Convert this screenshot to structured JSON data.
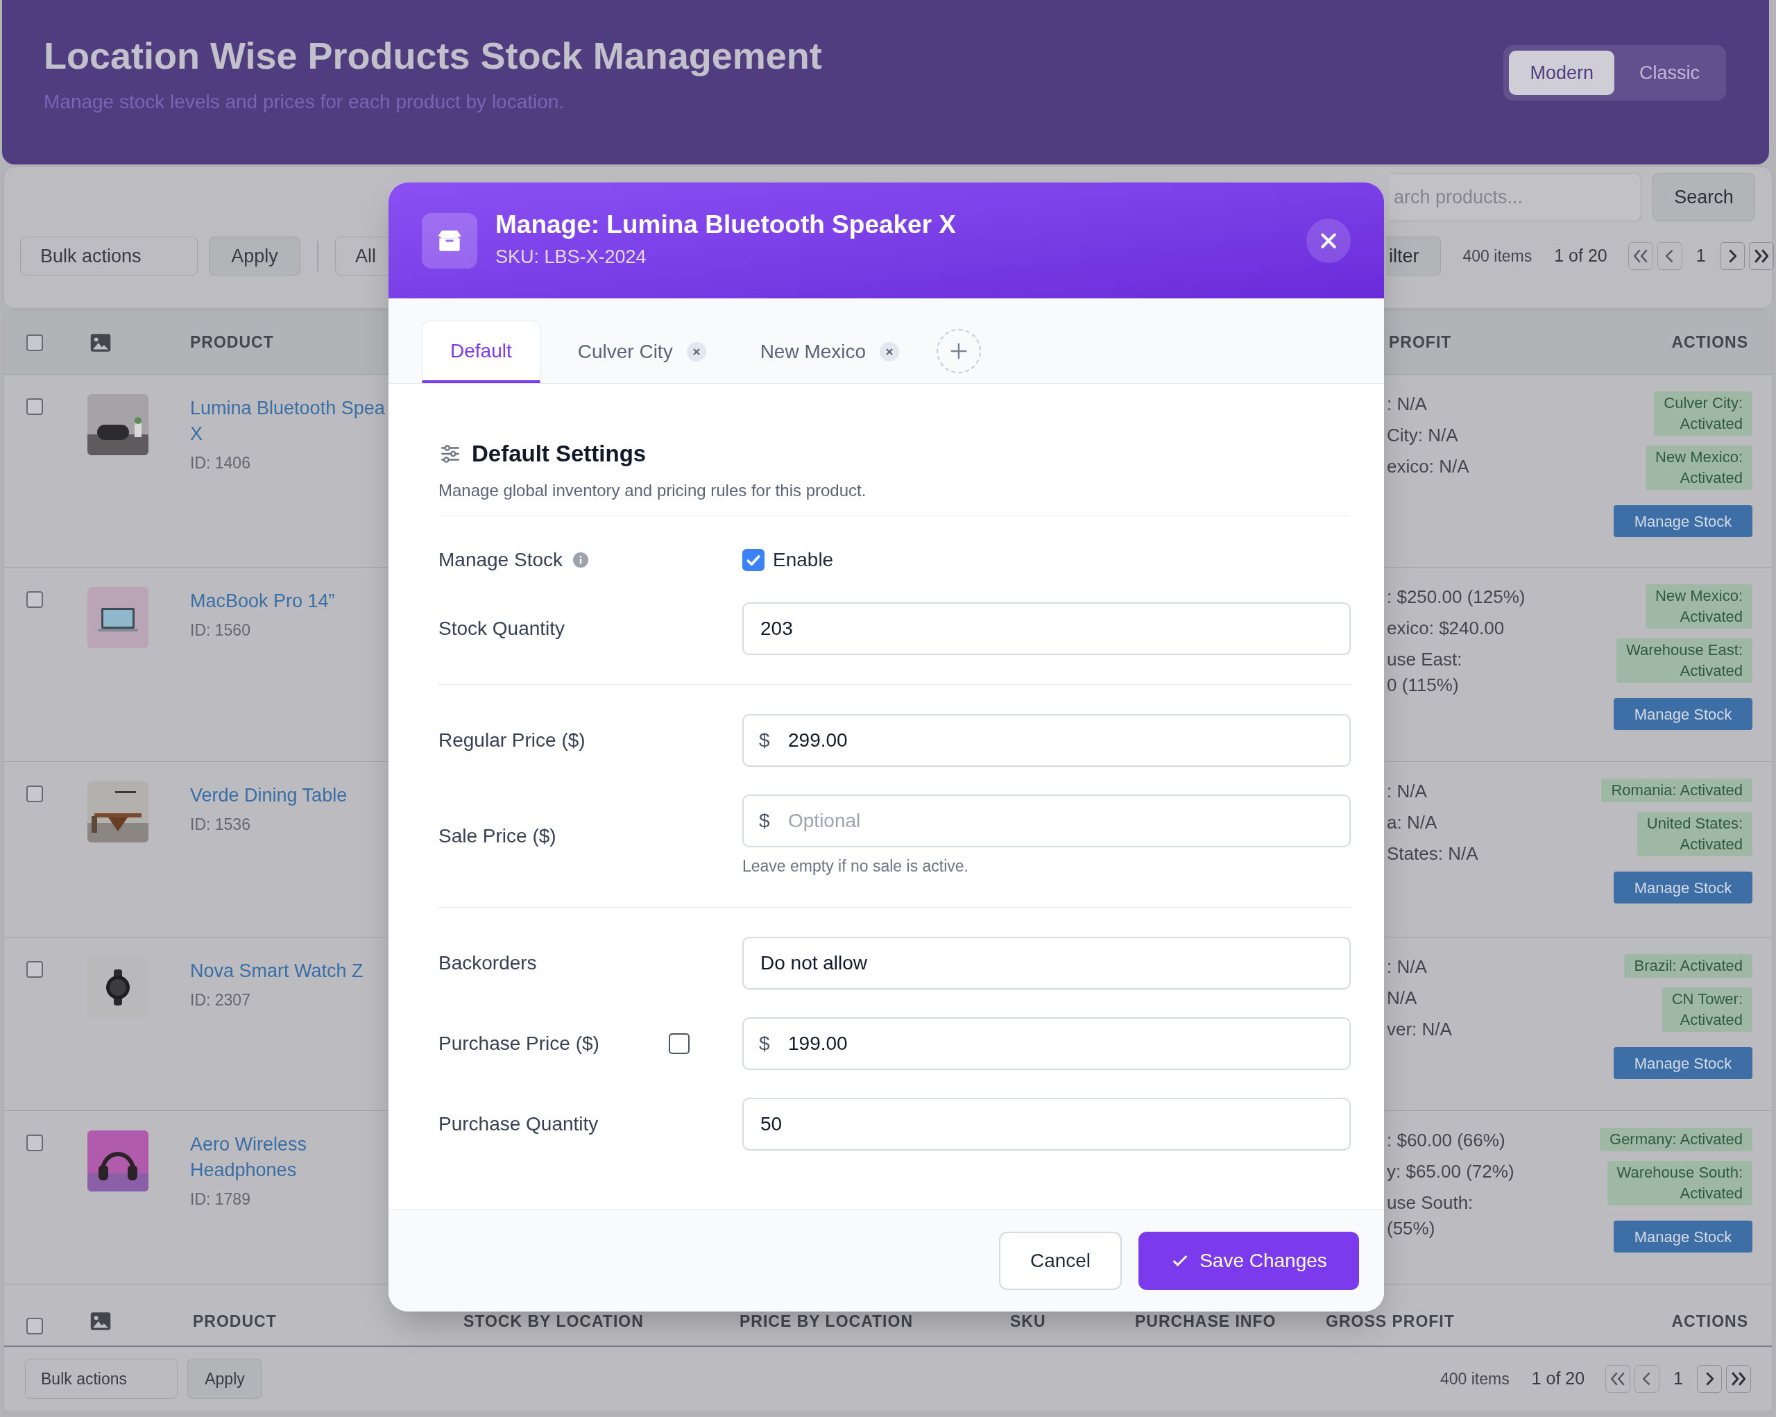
{
  "header": {
    "title": "Location Wise Products Stock Management",
    "subtitle": "Manage stock levels and prices for each product by location.",
    "view_toggle": [
      {
        "label": "Modern",
        "selected": true
      },
      {
        "label": "Classic",
        "selected": false
      }
    ]
  },
  "toolbar": {
    "bulk_actions": "Bulk actions",
    "apply": "Apply",
    "filter_select": "All",
    "filter_button": "ilter",
    "search": {
      "placeholder": "arch products..."
    },
    "search_button": "Search",
    "items_count": "400 items",
    "page_info": "1 of 20",
    "current_page": "1"
  },
  "table": {
    "header_checked": false,
    "columns_top": [
      "PRODUCT",
      "PROFIT",
      "ACTIONS"
    ],
    "rows": [
      {
        "checked": false,
        "name": "Lumina Bluetooth Spea\nX",
        "id": "ID: 1406",
        "gross_profit": [
          ": N/A",
          "City: N/A",
          "exico: N/A"
        ],
        "locations": [
          "Culver City:\nActivated",
          "New Mexico:\nActivated"
        ],
        "action": "Manage Stock"
      },
      {
        "checked": false,
        "name": "MacBook Pro 14”",
        "id": "ID: 1560",
        "gross_profit": [
          ": $250.00 (125%)",
          "exico: $240.00",
          "use East:\n0 (115%)"
        ],
        "locations": [
          "New Mexico:\nActivated",
          "Warehouse East:\nActivated"
        ],
        "action": "Manage Stock"
      },
      {
        "checked": false,
        "name": "Verde Dining Table",
        "id": "ID: 1536",
        "gross_profit": [
          ": N/A",
          "a: N/A",
          "States: N/A"
        ],
        "locations": [
          "Romania: Activated",
          "United States:\nActivated"
        ],
        "action": "Manage Stock"
      },
      {
        "checked": false,
        "name": "Nova Smart Watch Z",
        "id": "ID: 2307",
        "gross_profit": [
          ": N/A",
          "N/A",
          "ver: N/A"
        ],
        "locations": [
          "Brazil: Activated",
          "CN Tower:\nActivated"
        ],
        "action": "Manage Stock"
      },
      {
        "checked": false,
        "name": "Aero Wireless Headphones",
        "id": "ID: 1789",
        "gross_profit": [
          ": $60.00 (66%)",
          "y: $65.00 (72%)",
          "use South:\n (55%)"
        ],
        "locations": [
          "Germany: Activated",
          "Warehouse South:\nActivated"
        ],
        "action": "Manage Stock"
      }
    ],
    "footer_checked": false,
    "columns_bottom": [
      "PRODUCT",
      "STOCK BY LOCATION",
      "PRICE BY LOCATION",
      "SKU",
      "PURCHASE INFO",
      "GROSS PROFIT",
      "ACTIONS"
    ]
  },
  "bottom_bar": {
    "bulk_actions": "Bulk actions",
    "apply": "Apply",
    "items_count": "400 items",
    "page_info": "1 of 20",
    "current_page": "1"
  },
  "modal": {
    "title": "Manage: Lumina Bluetooth Speaker X",
    "sku": "SKU: LBS-X-2024",
    "tabs": [
      {
        "label": "Default",
        "selected": true,
        "removable": false
      },
      {
        "label": "Culver City",
        "selected": false,
        "removable": true
      },
      {
        "label": "New Mexico",
        "selected": false,
        "removable": true
      }
    ],
    "section_title": "Default Settings",
    "section_description": "Manage global inventory and pricing rules for this product.",
    "groups": [
      [
        {
          "kind": "checkbox",
          "label": "Manage Stock",
          "info": true,
          "checked": true,
          "option": "Enable"
        },
        {
          "kind": "input",
          "label": "Stock Quantity",
          "value": "203"
        }
      ],
      [
        {
          "kind": "input",
          "label": "Regular Price ($)",
          "prefix": "$",
          "value": "299.00"
        },
        {
          "kind": "input",
          "label": "Sale Price ($)",
          "prefix": "$",
          "placeholder": "Optional",
          "hint": "Leave empty if no sale is active."
        }
      ],
      [
        {
          "kind": "input",
          "label": "Backorders",
          "value": "Do not allow"
        },
        {
          "kind": "input",
          "label": "Purchase Price ($)",
          "prefix": "$",
          "value": "199.00",
          "checkbox": {
            "checked": false
          }
        },
        {
          "kind": "input",
          "label": "Purchase Quantity",
          "value": "50"
        }
      ]
    ],
    "cancel": "Cancel",
    "save": "Save Changes"
  }
}
